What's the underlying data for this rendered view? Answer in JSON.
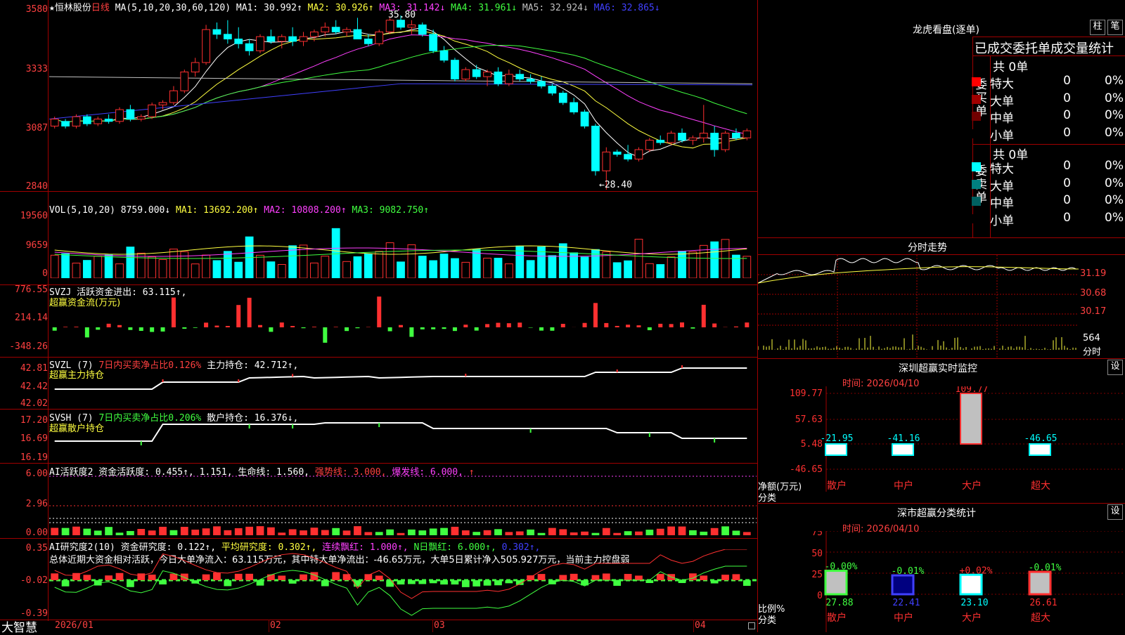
{
  "app": {
    "brand": "大智慧"
  },
  "main": {
    "title_star": "★",
    "stock_name": "恒林股份",
    "period": "日线",
    "ma_label": "MA(5,10,20,30,60,120)",
    "ma_values": [
      {
        "label": "MA1: 30.992↑",
        "color": "#ffffff"
      },
      {
        "label": "MA2: 30.926↑",
        "color": "#ffff40"
      },
      {
        "label": "MA3: 31.142↓",
        "color": "#ff40ff"
      },
      {
        "label": "MA4: 31.961↓",
        "color": "#40ff40"
      },
      {
        "label": "MA5: 32.924↓",
        "color": "#c0c0c0"
      },
      {
        "label": "MA6: 32.865↓",
        "color": "#4040ff"
      }
    ],
    "price_axis": [
      "3580",
      "3333",
      "3087",
      "2840"
    ],
    "high_mark": "35.80",
    "low_mark": "←28.40"
  },
  "volume": {
    "header": "VOL(5,10,20)",
    "value": "8759.000↓",
    "ma": [
      {
        "label": "MA1: 13692.200↑",
        "color": "#ffff40"
      },
      {
        "label": "MA2: 10808.200↑",
        "color": "#ff40ff"
      },
      {
        "label": "MA3: 9082.750↑",
        "color": "#40ff40"
      }
    ],
    "axis": [
      "19560",
      "9659",
      "0"
    ]
  },
  "svzj": {
    "header": "SVZJ  活跃资金进出: 63.115↑,",
    "subtitle": "超赢资金流(万元)",
    "axis": [
      "776.55",
      "214.14",
      "-348.26"
    ]
  },
  "svzl": {
    "header_a": "SVZL (7)",
    "header_b": "7日内买卖净占比0.126%",
    "header_c": "主力持仓: 42.712↑,",
    "subtitle": "超赢主力持仓",
    "axis": [
      "42.81",
      "42.42",
      "42.02"
    ]
  },
  "svsh": {
    "header_a": "SVSH (7)",
    "header_b": "7日内买卖净占比0.206%",
    "header_c": "散户持仓: 16.376↓,",
    "subtitle": "超赢散户持仓",
    "axis": [
      "17.20",
      "16.69",
      "16.19"
    ]
  },
  "ai_activity": {
    "header_a": "AI活跃度2 资金活跃度: 0.455↑, 1.151, 生命线: 1.560,",
    "header_b": "强势线: 3.000,",
    "header_c": "爆发线: 6.000,",
    "header_d": "↑",
    "axis": [
      "6.00",
      "2.96",
      "0.00"
    ]
  },
  "ai_research": {
    "header_a": "AI研究度2(10) 资金研究度: 0.122↑,",
    "header_b": "平均研究度: 0.302↑,",
    "header_c": "连续飘红: 1.000↑,",
    "header_d": "N日飘红: 6.000↑,",
    "header_e": "0.302↑,",
    "summary": "总体近期大资金相对活跃，今日大单净流入：63.115万元，其中特大单净流出：-46.65万元，大单5日累计净入505.927万元，当前主力控盘弱",
    "axis": [
      "0.35",
      "-0.02",
      "-0.39"
    ]
  },
  "x_axis": [
    "2026/01",
    "02",
    "03",
    "04"
  ],
  "right": {
    "dragon_title": "龙虎看盘(逐单)",
    "btn_zhu": "柱",
    "btn_bi": "笔",
    "stats_title": "已成交委托单成交量统计",
    "buy": {
      "side": "委买单",
      "total": "共 0单",
      "rows": [
        {
          "label": "特大",
          "v": "0",
          "p": "0%",
          "color": "#ff0000"
        },
        {
          "label": "大单",
          "v": "0",
          "p": "0%",
          "color": "#a00000"
        },
        {
          "label": "中单",
          "v": "0",
          "p": "0%",
          "color": "#700000"
        },
        {
          "label": "小单",
          "v": "0",
          "p": "0%",
          "color": "#000000"
        }
      ]
    },
    "sell": {
      "side": "委卖单",
      "total": "共 0单",
      "rows": [
        {
          "label": "特大",
          "v": "0",
          "p": "0%",
          "color": "#00ffff"
        },
        {
          "label": "大单",
          "v": "0",
          "p": "0%",
          "color": "#008080"
        },
        {
          "label": "中单",
          "v": "0",
          "p": "0%",
          "color": "#006060"
        },
        {
          "label": "小单",
          "v": "0",
          "p": "0%",
          "color": "#000000"
        }
      ]
    },
    "intraday_title": "分时走势",
    "intraday_axis": [
      "31.19",
      "30.68",
      "30.17"
    ],
    "intraday_vol": "564",
    "intraday_vol_unit": "分时",
    "sz_monitor_title": "深圳超赢实时监控",
    "settings": "设",
    "time_label": "时间: 2026/04/10",
    "monitor_axis": [
      "109.77",
      "57.63",
      "5.48",
      "-46.65"
    ],
    "monitor_ylabel": "净额(万元)",
    "category_label": "分类",
    "categories": [
      "散户",
      "中户",
      "大户",
      "超大"
    ],
    "monitor_values": [
      "-21.95",
      "-41.16",
      "109.77",
      "-46.65"
    ],
    "classify_title": "深市超赢分类统计",
    "class_time": "时间: 2026/04/10",
    "class_axis": [
      "75",
      "50",
      "25",
      "0"
    ],
    "class_ylabel": "比例%",
    "class_changes": [
      "-0.00%",
      "-0.01%",
      "+0.02%",
      "-0.01%"
    ],
    "class_values": [
      "27.88",
      "22.41",
      "23.10",
      "26.61"
    ]
  },
  "chart_data": {
    "type": "candlestick",
    "ohlc_approx": [
      [
        31.1,
        31.5,
        31.0,
        31.4
      ],
      [
        31.3,
        31.4,
        31.0,
        31.1
      ],
      [
        31.1,
        31.6,
        31.0,
        31.5
      ],
      [
        31.5,
        31.6,
        31.1,
        31.2
      ],
      [
        31.2,
        31.5,
        31.1,
        31.4
      ],
      [
        31.4,
        31.6,
        31.2,
        31.3
      ],
      [
        31.3,
        31.9,
        31.2,
        31.8
      ],
      [
        31.8,
        32.0,
        31.3,
        31.4
      ],
      [
        31.4,
        31.6,
        31.3,
        31.5
      ],
      [
        31.5,
        32.1,
        31.4,
        32.0
      ],
      [
        32.0,
        32.2,
        31.8,
        32.1
      ],
      [
        32.1,
        32.8,
        32.0,
        32.6
      ],
      [
        32.6,
        33.5,
        32.5,
        33.4
      ],
      [
        33.4,
        34.0,
        33.2,
        33.8
      ],
      [
        33.8,
        35.4,
        33.7,
        35.2
      ],
      [
        35.2,
        35.5,
        34.8,
        35.0
      ],
      [
        35.0,
        35.6,
        34.6,
        34.8
      ],
      [
        34.8,
        35.3,
        34.4,
        34.6
      ],
      [
        34.6,
        34.8,
        34.1,
        34.3
      ],
      [
        34.3,
        35.0,
        34.2,
        34.9
      ],
      [
        34.9,
        35.2,
        34.6,
        34.7
      ],
      [
        34.7,
        35.0,
        34.4,
        34.9
      ],
      [
        34.9,
        35.3,
        34.5,
        34.7
      ],
      [
        34.7,
        35.1,
        34.5,
        34.9
      ],
      [
        34.9,
        35.2,
        34.7,
        35.1
      ],
      [
        35.1,
        35.5,
        34.9,
        35.3
      ],
      [
        35.3,
        35.6,
        35.0,
        35.1
      ],
      [
        35.1,
        35.3,
        34.9,
        35.2
      ],
      [
        35.2,
        35.7,
        35.0,
        34.8
      ],
      [
        34.8,
        35.0,
        34.5,
        34.6
      ],
      [
        34.6,
        35.2,
        34.5,
        35.1
      ],
      [
        35.1,
        35.7,
        35.0,
        35.6
      ],
      [
        35.6,
        35.8,
        35.2,
        35.3
      ],
      [
        35.3,
        35.6,
        35.0,
        35.4
      ],
      [
        35.4,
        35.5,
        34.9,
        35.0
      ],
      [
        35.0,
        35.2,
        34.2,
        34.3
      ],
      [
        34.3,
        34.5,
        33.8,
        33.9
      ],
      [
        33.9,
        34.0,
        33.0,
        33.1
      ],
      [
        33.1,
        33.6,
        33.0,
        33.5
      ],
      [
        33.5,
        33.7,
        33.1,
        33.2
      ],
      [
        33.2,
        33.5,
        32.8,
        33.4
      ],
      [
        33.4,
        33.6,
        32.8,
        32.9
      ],
      [
        32.9,
        33.5,
        32.8,
        33.3
      ],
      [
        33.3,
        33.5,
        33.0,
        33.1
      ],
      [
        33.1,
        33.3,
        32.9,
        33.0
      ],
      [
        33.0,
        33.2,
        32.7,
        32.8
      ],
      [
        32.8,
        32.9,
        32.4,
        32.5
      ],
      [
        32.5,
        32.6,
        32.0,
        32.1
      ],
      [
        32.1,
        32.3,
        31.6,
        31.7
      ],
      [
        31.7,
        31.8,
        31.0,
        31.1
      ],
      [
        31.1,
        31.2,
        29.0,
        29.2
      ],
      [
        29.2,
        30.2,
        28.4,
        30.0
      ],
      [
        30.0,
        30.1,
        29.8,
        29.9
      ],
      [
        29.9,
        30.3,
        29.6,
        29.7
      ],
      [
        29.7,
        30.2,
        29.6,
        30.1
      ],
      [
        30.1,
        30.6,
        30.0,
        30.5
      ],
      [
        30.5,
        30.7,
        30.3,
        30.4
      ],
      [
        30.4,
        30.9,
        30.3,
        30.8
      ],
      [
        30.8,
        31.0,
        30.4,
        30.5
      ],
      [
        30.5,
        30.7,
        30.3,
        30.6
      ],
      [
        30.6,
        32.0,
        30.4,
        30.8
      ],
      [
        30.8,
        31.1,
        29.8,
        30.1
      ],
      [
        30.1,
        30.9,
        30.0,
        30.8
      ],
      [
        30.8,
        31.0,
        30.5,
        30.6
      ],
      [
        30.6,
        31.0,
        30.5,
        30.9
      ]
    ],
    "price_ylim": [
      28.4,
      35.8
    ]
  }
}
